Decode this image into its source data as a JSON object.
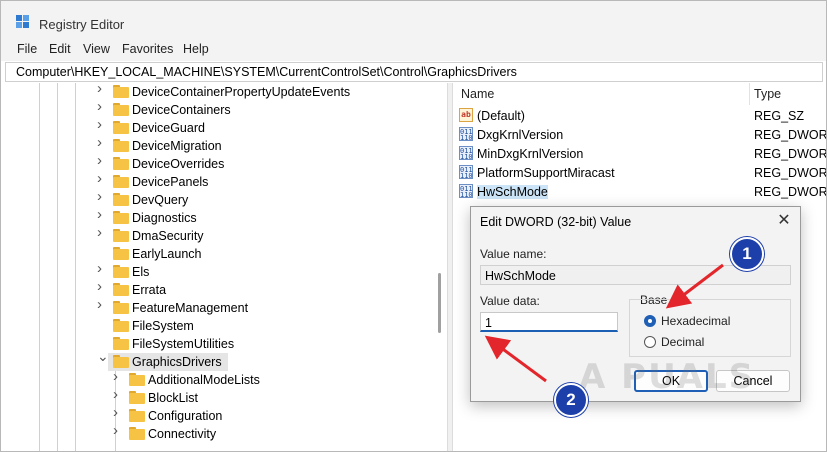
{
  "window": {
    "title": "Registry Editor"
  },
  "menu": [
    "File",
    "Edit",
    "View",
    "Favorites",
    "Help"
  ],
  "address": "Computer\\HKEY_LOCAL_MACHINE\\SYSTEM\\CurrentControlSet\\Control\\GraphicsDrivers",
  "tree": {
    "items": [
      {
        "label": "DeviceContainerPropertyUpdateEvents",
        "level": 0,
        "expander": "collapsed"
      },
      {
        "label": "DeviceContainers",
        "level": 0,
        "expander": "collapsed"
      },
      {
        "label": "DeviceGuard",
        "level": 0,
        "expander": "collapsed"
      },
      {
        "label": "DeviceMigration",
        "level": 0,
        "expander": "collapsed"
      },
      {
        "label": "DeviceOverrides",
        "level": 0,
        "expander": "collapsed"
      },
      {
        "label": "DevicePanels",
        "level": 0,
        "expander": "collapsed"
      },
      {
        "label": "DevQuery",
        "level": 0,
        "expander": "collapsed"
      },
      {
        "label": "Diagnostics",
        "level": 0,
        "expander": "collapsed"
      },
      {
        "label": "DmaSecurity",
        "level": 0,
        "expander": "collapsed"
      },
      {
        "label": "EarlyLaunch",
        "level": 0,
        "expander": "none"
      },
      {
        "label": "Els",
        "level": 0,
        "expander": "collapsed"
      },
      {
        "label": "Errata",
        "level": 0,
        "expander": "collapsed"
      },
      {
        "label": "FeatureManagement",
        "level": 0,
        "expander": "collapsed"
      },
      {
        "label": "FileSystem",
        "level": 0,
        "expander": "none"
      },
      {
        "label": "FileSystemUtilities",
        "level": 0,
        "expander": "none"
      },
      {
        "label": "GraphicsDrivers",
        "level": 0,
        "expander": "expanded",
        "selected": true
      },
      {
        "label": "AdditionalModeLists",
        "level": 1,
        "expander": "collapsed"
      },
      {
        "label": "BlockList",
        "level": 1,
        "expander": "collapsed"
      },
      {
        "label": "Configuration",
        "level": 1,
        "expander": "collapsed"
      },
      {
        "label": "Connectivity",
        "level": 1,
        "expander": "collapsed"
      }
    ]
  },
  "values_pane": {
    "columns": {
      "name": "Name",
      "type": "Type"
    },
    "rows": [
      {
        "icon": "string-value-icon",
        "icon_text": "ab",
        "name": "(Default)",
        "type": "REG_SZ"
      },
      {
        "icon": "binary-value-icon",
        "icon_text": "011\n110",
        "name": "DxgKrnlVersion",
        "type": "REG_DWORD"
      },
      {
        "icon": "binary-value-icon",
        "icon_text": "011\n110",
        "name": "MinDxgKrnlVersion",
        "type": "REG_DWORD"
      },
      {
        "icon": "binary-value-icon",
        "icon_text": "011\n110",
        "name": "PlatformSupportMiracast",
        "type": "REG_DWORD"
      },
      {
        "icon": "binary-value-icon",
        "icon_text": "011\n110",
        "name": "HwSchMode",
        "type": "REG_DWORD",
        "selected": true
      }
    ]
  },
  "dialog": {
    "title": "Edit DWORD (32-bit) Value",
    "value_name_label": "Value name:",
    "value_name": "HwSchMode",
    "value_data_label": "Value data:",
    "value_data": "1",
    "base_label": "Base",
    "base_options": [
      {
        "label": "Hexadecimal",
        "checked": true
      },
      {
        "label": "Decimal",
        "checked": false
      }
    ],
    "ok_label": "OK",
    "cancel_label": "Cancel"
  },
  "annotations": {
    "badge_1": "1",
    "badge_2": "2",
    "arrow_color": "#e3262b",
    "badge_color": "#1d3faa"
  },
  "watermark": "A PUALS"
}
